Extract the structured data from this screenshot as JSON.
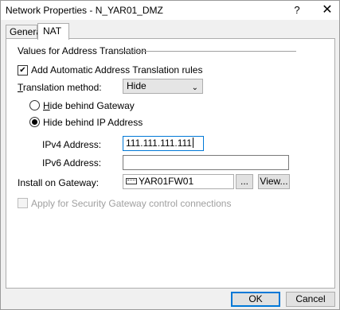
{
  "window": {
    "title": "Network Properties - N_YAR01_DMZ",
    "help_label": "?",
    "close_label": "✕"
  },
  "tabs": [
    {
      "label": "General",
      "active": false
    },
    {
      "label": "NAT",
      "active": true
    }
  ],
  "nat": {
    "group_title": "Values for Address Translation",
    "auto_nat": {
      "label": "Add Automatic Address Translation rules",
      "checked": true
    },
    "translation_method": {
      "label": "Translation method:",
      "value": "Hide",
      "arrow": "⌄"
    },
    "hide_options": [
      {
        "label": "Hide behind Gateway",
        "selected": false
      },
      {
        "label": "Hide behind IP Address",
        "selected": true
      }
    ],
    "ipv4": {
      "label": "IPv4 Address:",
      "value": "111.111.111.111"
    },
    "ipv6": {
      "label": "IPv6 Address:",
      "value": ""
    },
    "install_on": {
      "label": "Install on Gateway:",
      "value": "YAR01FW01",
      "browse_label": "...",
      "view_label": "View..."
    },
    "apply_sgw": {
      "label": "Apply for Security Gateway control connections",
      "checked": false,
      "disabled": true
    }
  },
  "footer": {
    "ok_label": "OK",
    "cancel_label": "Cancel"
  }
}
